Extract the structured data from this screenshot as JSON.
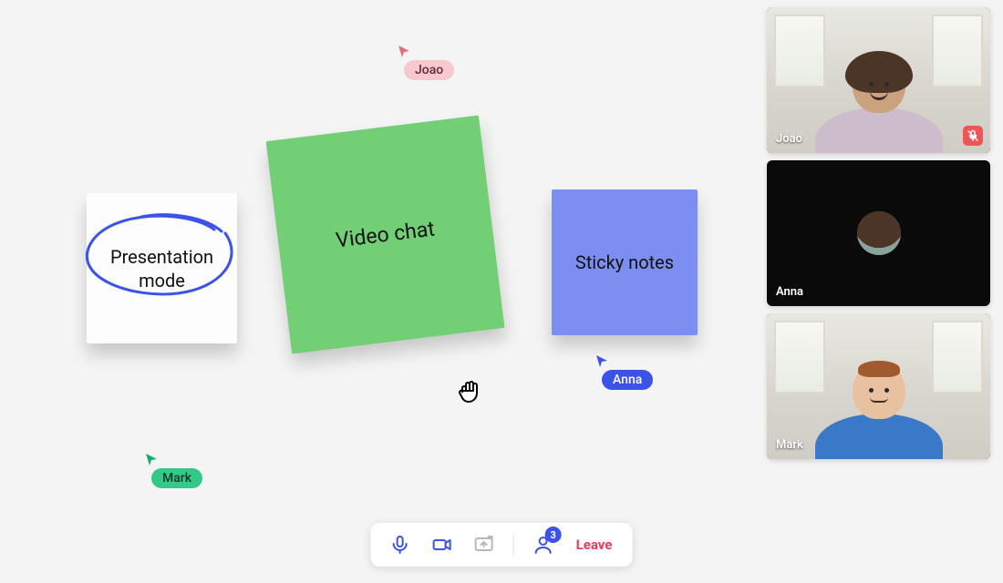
{
  "canvas": {
    "notes": {
      "white": "Presentation\nmode",
      "green": "Video chat",
      "blue": "Sticky notes"
    },
    "cursors": {
      "joao": "Joao",
      "anna": "Anna",
      "mark": "Mark"
    }
  },
  "video": {
    "tiles": [
      {
        "name": "Joao",
        "cameraOn": true,
        "muted": true
      },
      {
        "name": "Anna",
        "cameraOn": false,
        "muted": false
      },
      {
        "name": "Mark",
        "cameraOn": true,
        "muted": false
      }
    ]
  },
  "toolbar": {
    "participant_count": "3",
    "leave_label": "Leave"
  },
  "icons": {
    "mic": "microphone-icon",
    "camera": "camera-icon",
    "share": "screenshare-icon",
    "participants": "participants-icon",
    "muted": "mic-muted-icon",
    "hand": "grab-hand-icon"
  },
  "colors": {
    "accent": "#3b53e8",
    "danger": "#e83b5f",
    "note_green": "#73cf76",
    "note_blue": "#7c8ff0",
    "cursor_pink": "#f7c8cd",
    "cursor_blue": "#3b53e8",
    "cursor_green": "#33c989"
  }
}
